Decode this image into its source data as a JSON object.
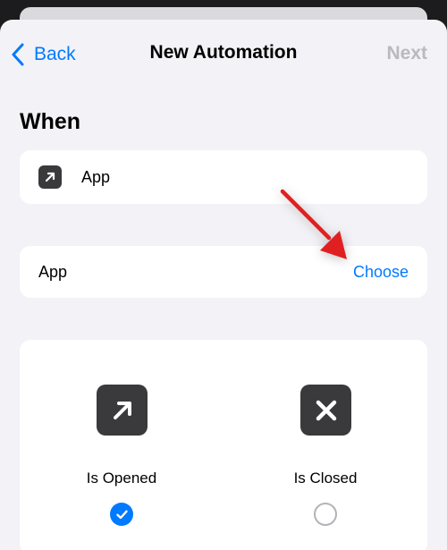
{
  "nav": {
    "back_label": "Back",
    "title": "New Automation",
    "next_label": "Next"
  },
  "section": {
    "header": "When"
  },
  "trigger": {
    "icon": "app-arrow-icon",
    "label": "App"
  },
  "app_row": {
    "label": "App",
    "choose_label": "Choose"
  },
  "options": [
    {
      "label": "Is Opened",
      "icon": "app-arrow-icon",
      "checked": true
    },
    {
      "label": "Is Closed",
      "icon": "close-icon",
      "checked": false
    }
  ],
  "colors": {
    "accent": "#007aff",
    "disabled": "#b9b9be",
    "annotation_arrow": "#e02020"
  }
}
